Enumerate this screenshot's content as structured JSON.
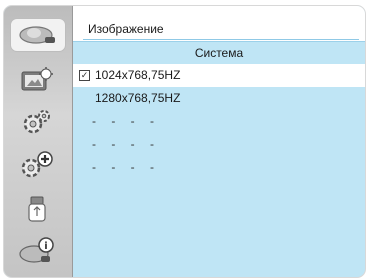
{
  "header": {
    "title": "Изображение"
  },
  "subtitle": "Система",
  "list": {
    "items": [
      {
        "label": "1024x768,75HZ",
        "checked": true
      },
      {
        "label": "1280x768,75HZ",
        "checked": false
      },
      {
        "label": "- - - -",
        "checked": false
      },
      {
        "label": "- - - -",
        "checked": false
      },
      {
        "label": "- - - -",
        "checked": false
      }
    ]
  },
  "sidebar": {
    "items": [
      {
        "icon": "projector-icon",
        "active": true
      },
      {
        "icon": "image-settings-icon",
        "active": false
      },
      {
        "icon": "gear-icon",
        "active": false
      },
      {
        "icon": "gear-plus-icon",
        "active": false
      },
      {
        "icon": "usb-icon",
        "active": false
      },
      {
        "icon": "projector-info-icon",
        "active": false
      }
    ]
  },
  "colors": {
    "content_bg": "#bfe5f5",
    "selected_row": "#ffffff",
    "sidebar_bg": "#c4c4c4"
  }
}
